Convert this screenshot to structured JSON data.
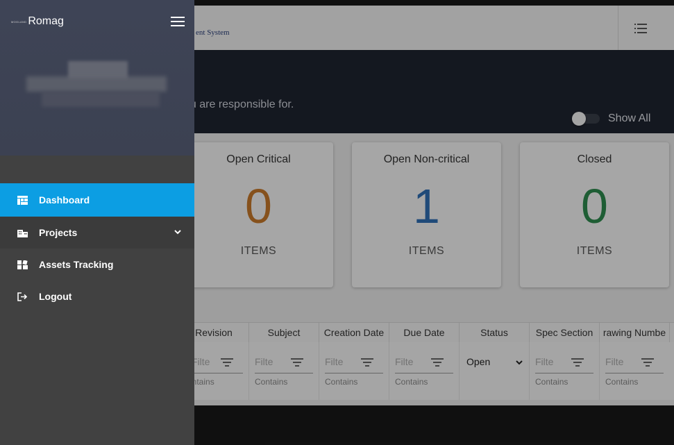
{
  "app": {
    "system_title_fragment": "ent System",
    "list_icon": "list-icon"
  },
  "hero": {
    "subtitle_fragment": "ou are responsible for.",
    "show_all_label": "Show All",
    "show_all_on": false
  },
  "cards": [
    {
      "title": "Open Critical",
      "count": "0",
      "unit": "ITEMS",
      "color": "#c87a2a"
    },
    {
      "title": "Open Non-critical",
      "count": "1",
      "unit": "ITEMS",
      "color": "#2f6fb5"
    },
    {
      "title": "Closed",
      "count": "0",
      "unit": "ITEMS",
      "color": "#2e8b4e"
    }
  ],
  "grid": {
    "columns": [
      "Revision",
      "Subject",
      "Creation Date",
      "Due Date",
      "Status",
      "Spec Section",
      "Drawing Number"
    ],
    "columns_visible": [
      "Revision",
      "Subject",
      "Creation Date",
      "Due Date",
      "Status",
      "Spec Section",
      "rawing Numbe"
    ],
    "filter_placeholder": "Filte",
    "filter_operator": "Contains",
    "filter_operator_partial": "ontains",
    "status_value": "Open"
  },
  "drawer": {
    "brand_small": "MOGLAND",
    "brand_name": "Romag",
    "menu_icon": "hamburger-icon",
    "items": [
      {
        "label": "Dashboard",
        "icon": "dashboard-icon",
        "active": true
      },
      {
        "label": "Projects",
        "icon": "building-icon",
        "expandable": true
      },
      {
        "label": "Assets Tracking",
        "icon": "assets-icon"
      },
      {
        "label": "Logout",
        "icon": "logout-icon"
      }
    ]
  },
  "colors": {
    "accent": "#0c9ee3",
    "drawer_bg": "#414141",
    "drawer_header": "#3e4456",
    "hero_bg": "#1f2430"
  }
}
